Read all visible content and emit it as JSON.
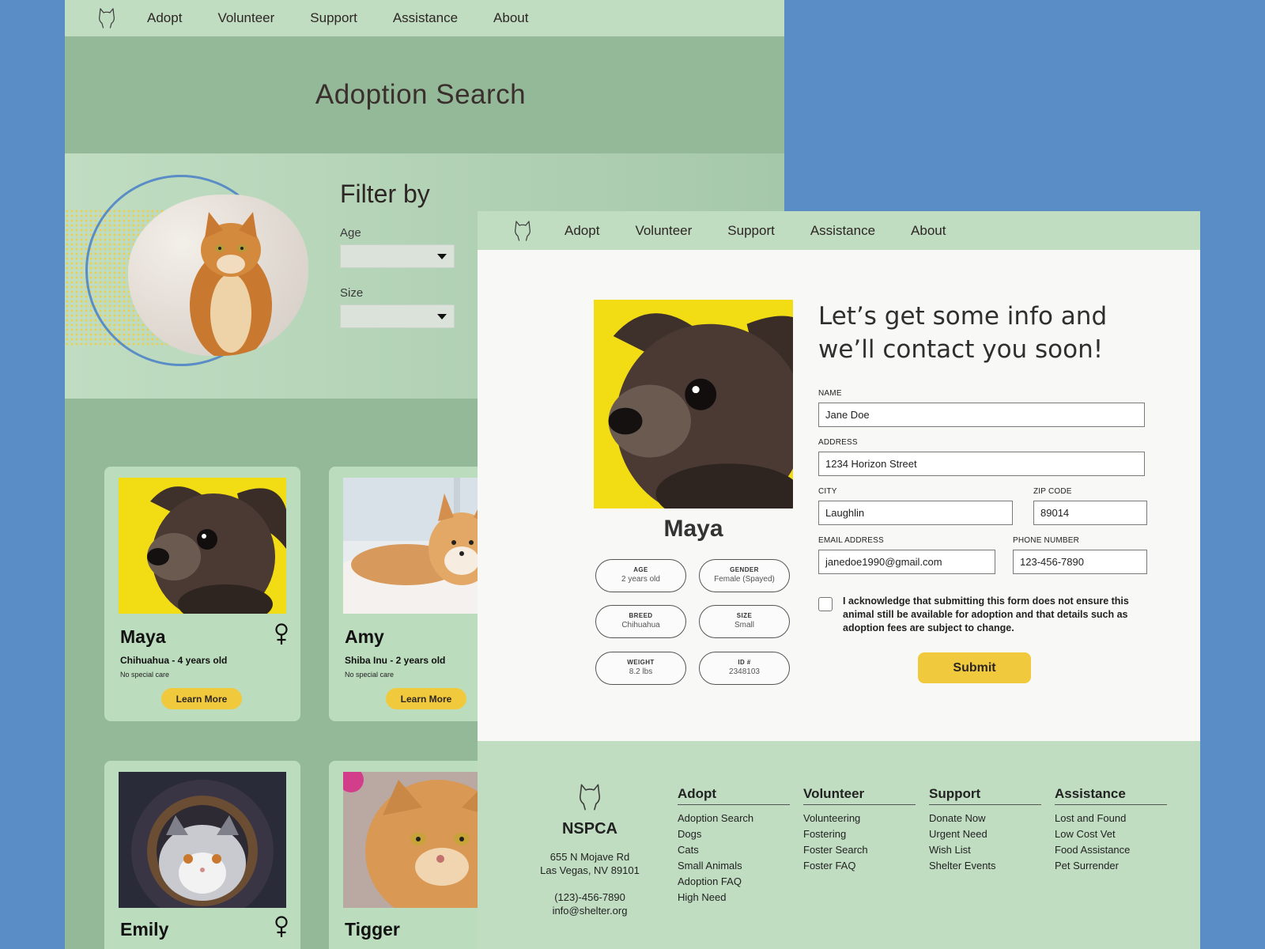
{
  "back": {
    "nav": [
      "Adopt",
      "Volunteer",
      "Support",
      "Assistance",
      "About"
    ],
    "title": "Adoption Search",
    "filter_title": "Filter by",
    "filters": [
      {
        "label": "Age",
        "value": ""
      },
      {
        "label": "Size",
        "value": ""
      }
    ],
    "cards": [
      {
        "name": "Maya",
        "meta": "Chihuahua - 4 years old",
        "care": "No special care",
        "button": "Learn More",
        "sex": "female"
      },
      {
        "name": "Amy",
        "meta": "Shiba Inu - 2 years old",
        "care": "No special care",
        "button": "Learn More",
        "sex": ""
      },
      {
        "name": "Emily",
        "meta": "",
        "care": "",
        "button": "",
        "sex": "female"
      },
      {
        "name": "Tigger",
        "meta": "",
        "care": "",
        "button": "",
        "sex": ""
      }
    ]
  },
  "front": {
    "nav": [
      "Adopt",
      "Volunteer",
      "Support",
      "Assistance",
      "About"
    ],
    "pet_name": "Maya",
    "attributes": [
      {
        "key": "AGE",
        "value": "2 years old"
      },
      {
        "key": "GENDER",
        "value": "Female (Spayed)"
      },
      {
        "key": "BREED",
        "value": "Chihuahua"
      },
      {
        "key": "SIZE",
        "value": "Small"
      },
      {
        "key": "WEIGHT",
        "value": "8.2 lbs"
      },
      {
        "key": "ID #",
        "value": "2348103"
      }
    ],
    "form": {
      "title": "Let’s get some info and we’ll contact you soon!",
      "name_label": "NAME",
      "name_value": "Jane Doe",
      "address_label": "ADDRESS",
      "address_value": "1234 Horizon Street",
      "city_label": "CITY",
      "city_value": "Laughlin",
      "zip_label": "ZIP CODE",
      "zip_value": "89014",
      "email_label": "EMAIL ADDRESS",
      "email_value": "janedoe1990@gmail.com",
      "phone_label": "PHONE NUMBER",
      "phone_value": "123-456-7890",
      "acknowledge": "I acknowledge that submitting this form does not ensure this animal still be available for adoption and that details such as adoption fees are subject to change.",
      "submit": "Submit"
    },
    "footer": {
      "org": "NSPCA",
      "address1": "655 N Mojave Rd",
      "address2": "Las Vegas, NV 89101",
      "phone": "(123)-456-7890",
      "email": "info@shelter.org",
      "columns": [
        {
          "heading": "Adopt",
          "items": [
            "Adoption Search",
            "Dogs",
            "Cats",
            "Small Animals",
            "Adoption FAQ",
            "High Need"
          ]
        },
        {
          "heading": "Volunteer",
          "items": [
            "Volunteering",
            "Fostering",
            "Foster Search",
            "Foster FAQ"
          ]
        },
        {
          "heading": "Support",
          "items": [
            "Donate Now",
            "Urgent Need",
            "Wish List",
            "Shelter Events"
          ]
        },
        {
          "heading": "Assistance",
          "items": [
            "Lost and Found",
            "Low Cost Vet",
            "Food Assistance",
            "Pet Surrender"
          ]
        }
      ]
    }
  },
  "colors": {
    "background": "#5a8cc6",
    "nav": "#c0ddc2",
    "page": "#93b999",
    "accent": "#f0ca3c",
    "card": "#bcdcbe"
  }
}
